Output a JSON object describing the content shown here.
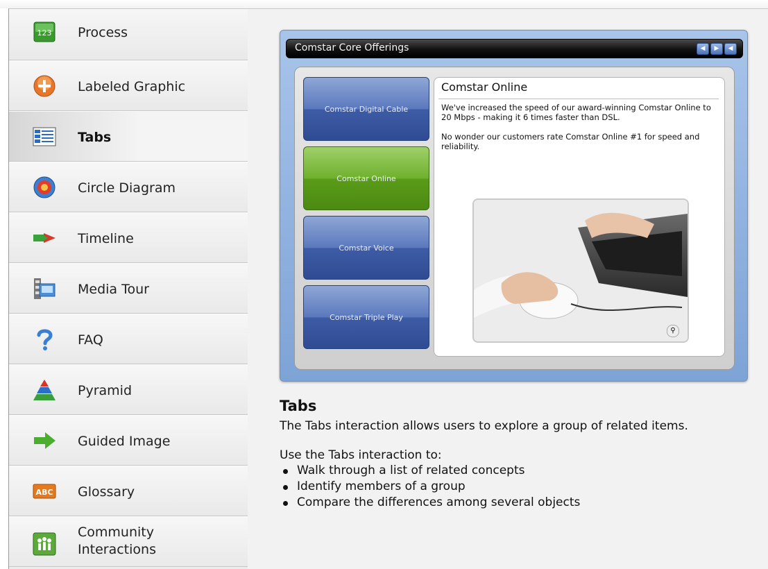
{
  "sidebar": {
    "items": [
      {
        "label": "Process",
        "icon": "number-steps-icon"
      },
      {
        "label": "Labeled Graphic",
        "icon": "plus-circle-icon"
      },
      {
        "label": "Tabs",
        "icon": "tabs-icon",
        "active": true
      },
      {
        "label": "Circle Diagram",
        "icon": "circle-target-icon"
      },
      {
        "label": "Timeline",
        "icon": "timeline-arrow-icon"
      },
      {
        "label": "Media Tour",
        "icon": "film-strip-icon"
      },
      {
        "label": "FAQ",
        "icon": "question-mark-icon"
      },
      {
        "label": "Pyramid",
        "icon": "pyramid-icon"
      },
      {
        "label": "Guided Image",
        "icon": "green-arrow-icon"
      },
      {
        "label": "Glossary",
        "icon": "abc-icon"
      },
      {
        "label": "Community Interactions",
        "icon": "people-icon"
      }
    ],
    "process_icon_text": "123",
    "glossary_icon_text": "ABC"
  },
  "preview": {
    "title": "Comstar Core Offerings",
    "nav": {
      "prev": "◀",
      "next": "▶",
      "back": "◀"
    },
    "tabs": [
      {
        "label": "Comstar Digital Cable"
      },
      {
        "label": "Comstar Online",
        "active": true
      },
      {
        "label": "Comstar Voice"
      },
      {
        "label": "Comstar Triple Play"
      }
    ],
    "panel": {
      "title": "Comstar Online",
      "para1": "We've increased the speed of our award-winning Comstar Online to 20 Mbps - making it 6 times faster than DSL.",
      "para2": "No wonder our customers rate Comstar Online #1 for speed and reliability.",
      "image": "hand-on-mouse-with-laptop-photo",
      "zoom_icon": "magnifier-icon"
    }
  },
  "description": {
    "heading": "Tabs",
    "para1": "The Tabs interaction allows users to explore a group of related items.",
    "para2": "Use the Tabs interaction to:",
    "bullets": [
      "Walk through a list of related concepts",
      "Identify members of a group",
      "Compare the differences among several objects"
    ]
  },
  "colors": {
    "tab_blue": "#3e5ca6",
    "tab_green": "#5a9c19",
    "preview_bg": "#8fb0df"
  }
}
